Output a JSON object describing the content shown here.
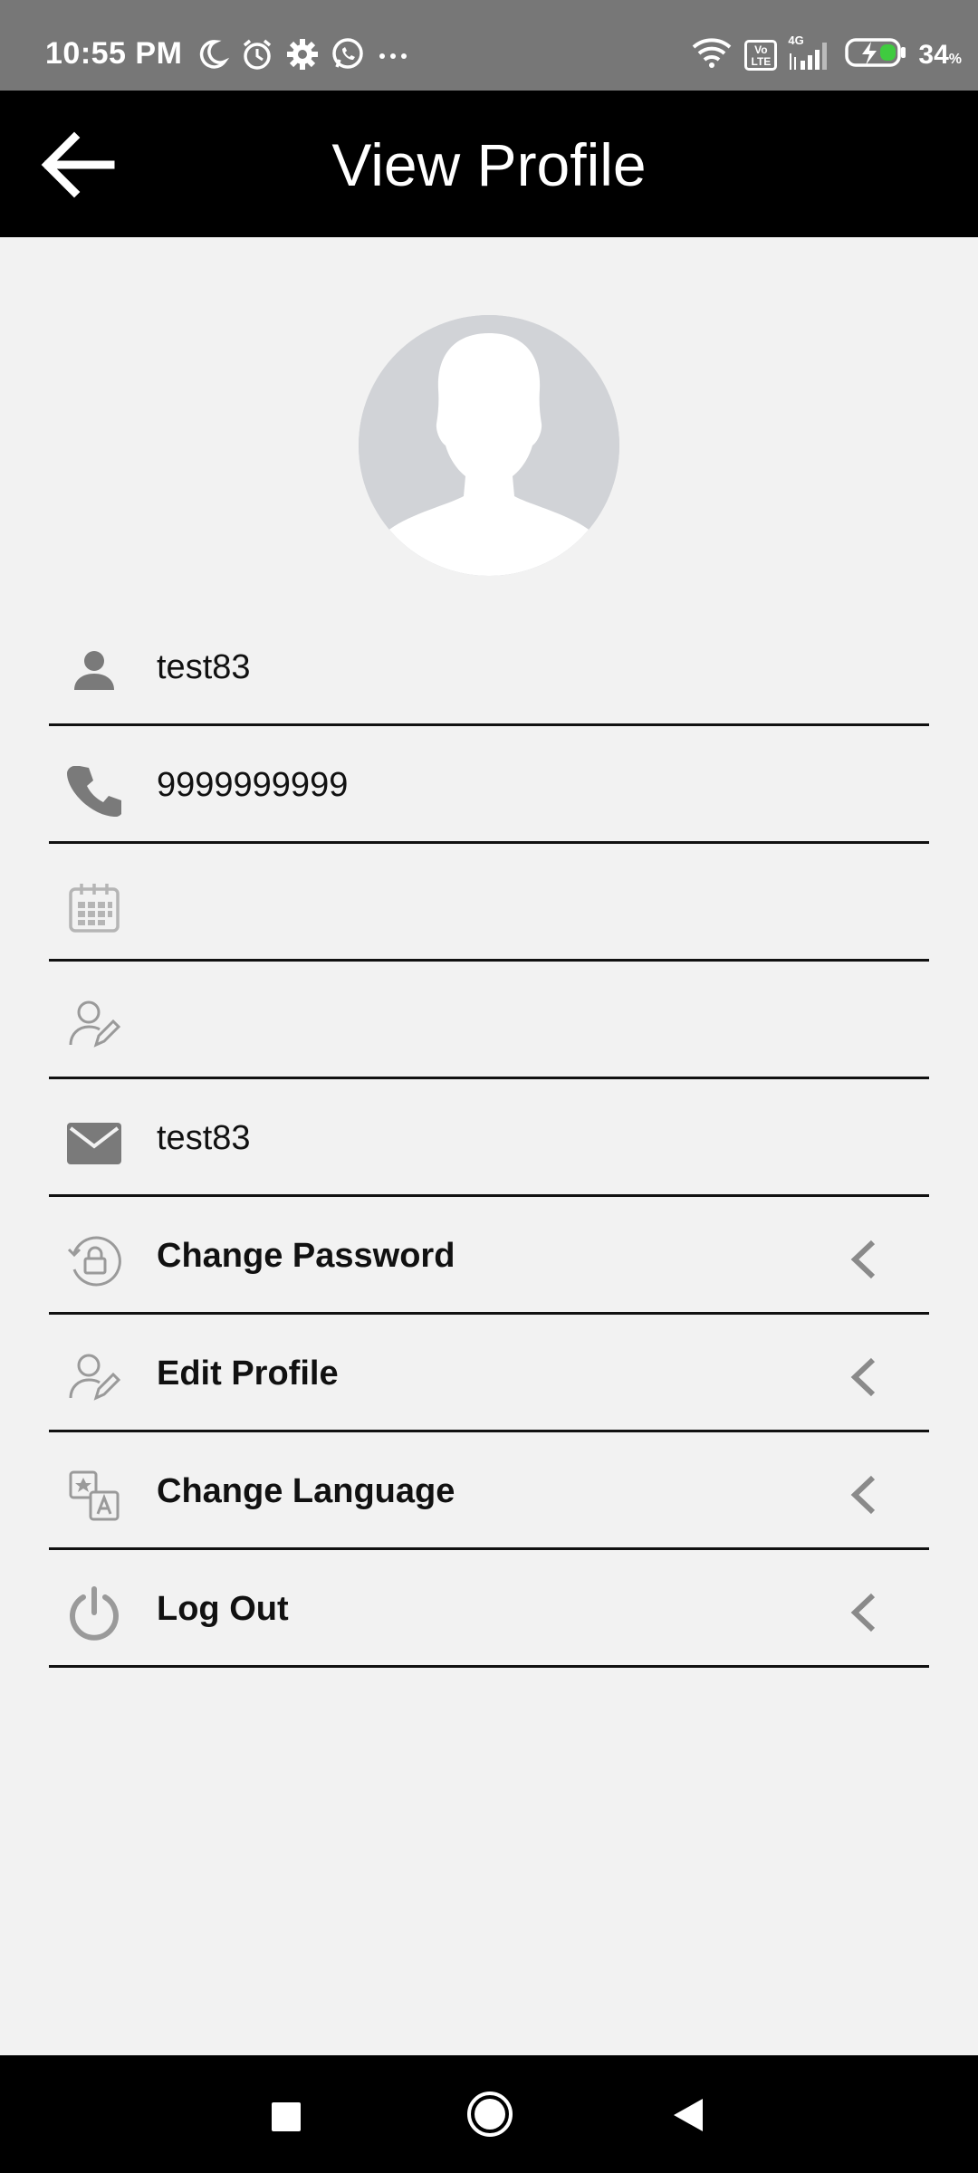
{
  "status_bar": {
    "time": "10:55 PM",
    "battery_percent": "34",
    "battery_unit": "%",
    "network_badge": "Vo LTE",
    "network_type": "4G"
  },
  "app_bar": {
    "title": "View Profile",
    "back_icon": "arrow-left-icon"
  },
  "profile": {
    "avatar_icon": "person-silhouette-icon",
    "fields": [
      {
        "icon": "person-icon",
        "value": "test83"
      },
      {
        "icon": "phone-icon",
        "value": "9999999999"
      },
      {
        "icon": "calendar-icon",
        "value": ""
      },
      {
        "icon": "user-edit-icon",
        "value": ""
      },
      {
        "icon": "mail-icon",
        "value": "test83"
      }
    ],
    "actions": [
      {
        "icon": "lock-rotate-icon",
        "label": "Change Password"
      },
      {
        "icon": "user-edit-icon",
        "label": "Edit Profile"
      },
      {
        "icon": "translate-icon",
        "label": "Change Language"
      },
      {
        "icon": "power-icon",
        "label": "Log Out"
      }
    ]
  },
  "colors": {
    "status_bar_bg": "#777777",
    "app_bar_bg": "#000000",
    "page_bg": "#f2f2f2",
    "icon_gray": "#7a7a7a",
    "divider": "#111111"
  }
}
